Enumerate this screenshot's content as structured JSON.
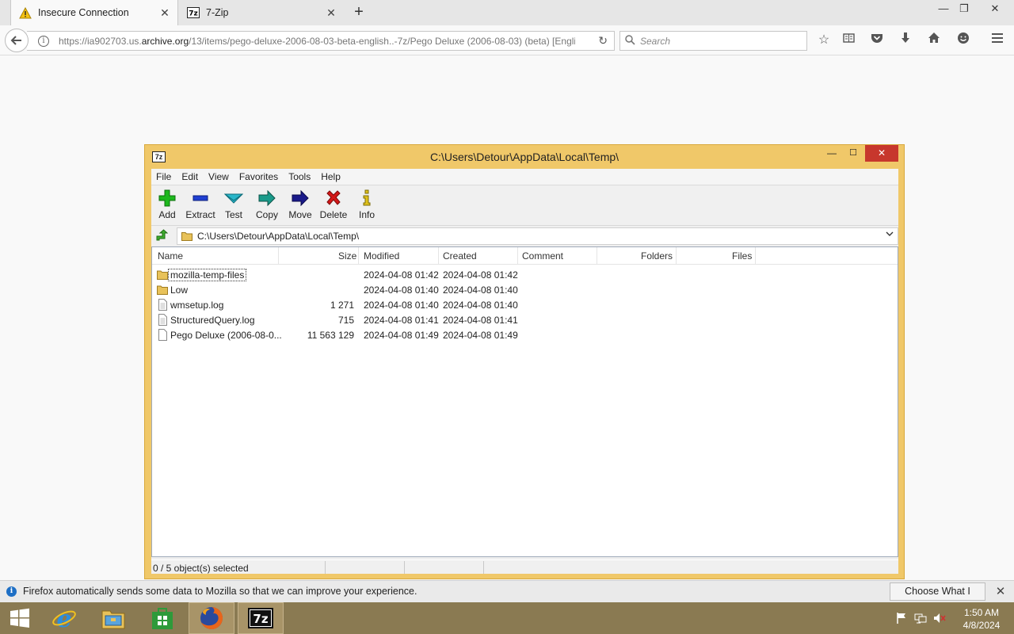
{
  "browser": {
    "tabs": [
      {
        "label": "Insecure Connection",
        "icon": "warning-icon",
        "active": true
      },
      {
        "label": "7-Zip",
        "icon": "7zip-icon",
        "active": false
      }
    ],
    "url": {
      "prefix": "https://ia902703.us.",
      "host": "archive.org",
      "rest": "/13/items/pego-deluxe-2006-08-03-beta-english..-7z/Pego Deluxe (2006-08-03) (beta) [Englis"
    },
    "search_placeholder": "Search"
  },
  "zip": {
    "title": "C:\\Users\\Detour\\AppData\\Local\\Temp\\",
    "menu": [
      "File",
      "Edit",
      "View",
      "Favorites",
      "Tools",
      "Help"
    ],
    "toolbar": [
      {
        "label": "Add",
        "icon": "add-icon",
        "color": "#1db81d"
      },
      {
        "label": "Extract",
        "icon": "extract-icon",
        "color": "#1f3fd1"
      },
      {
        "label": "Test",
        "icon": "test-icon",
        "color": "#2ab6c9"
      },
      {
        "label": "Copy",
        "icon": "copy-icon",
        "color": "#1a9a8a"
      },
      {
        "label": "Move",
        "icon": "move-icon",
        "color": "#1a1a8a"
      },
      {
        "label": "Delete",
        "icon": "delete-icon",
        "color": "#d41818"
      },
      {
        "label": "Info",
        "icon": "info-icon",
        "color": "#e0c21a"
      }
    ],
    "path": "C:\\Users\\Detour\\AppData\\Local\\Temp\\",
    "columns": [
      "Name",
      "Size",
      "Modified",
      "Created",
      "Comment",
      "Folders",
      "Files"
    ],
    "rows": [
      {
        "name": "mozilla-temp-files",
        "type": "folder",
        "size": "",
        "modified": "2024-04-08 01:42",
        "created": "2024-04-08 01:42"
      },
      {
        "name": "Low",
        "type": "folder",
        "size": "",
        "modified": "2024-04-08 01:40",
        "created": "2024-04-08 01:40"
      },
      {
        "name": "wmsetup.log",
        "type": "file",
        "size": "1 271",
        "modified": "2024-04-08 01:40",
        "created": "2024-04-08 01:40"
      },
      {
        "name": "StructuredQuery.log",
        "type": "file",
        "size": "715",
        "modified": "2024-04-08 01:41",
        "created": "2024-04-08 01:41"
      },
      {
        "name": "Pego Deluxe (2006-08-0...",
        "type": "file",
        "size": "11 563 129",
        "modified": "2024-04-08 01:49",
        "created": "2024-04-08 01:49"
      }
    ],
    "status": "0 / 5 object(s) selected"
  },
  "notification": {
    "text": "Firefox automatically sends some data to Mozilla so that we can improve your experience.",
    "button": "Choose What I Share"
  },
  "taskbar": {
    "time": "1:50 AM",
    "date": "4/8/2024",
    "apps": [
      "start-icon",
      "internet-explorer-icon",
      "file-explorer-icon",
      "store-icon",
      "firefox-icon",
      "7zip-icon"
    ]
  }
}
